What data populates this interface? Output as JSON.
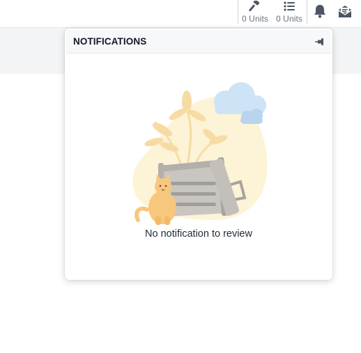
{
  "topbar": {
    "unit_counters": [
      {
        "icon": "gavel-icon",
        "label": "0 Units"
      },
      {
        "icon": "list-icon",
        "label": "0 Units"
      }
    ],
    "bell_icon": "bell-icon",
    "inbox_icon": "envelope-open-icon"
  },
  "notifications": {
    "title": "NOTIFICATIONS",
    "pin_icon": "pin-icon",
    "empty_message": "No notification to review",
    "illustration": "empty-trash-cat-illustration"
  },
  "colors": {
    "icon_gray": "#4b5563",
    "blob_yellow": "#fdf3d6",
    "cloud_blue": "#cfe3f7",
    "cat_orange": "#f7c77e",
    "can_gray": "#b9b6b2"
  }
}
